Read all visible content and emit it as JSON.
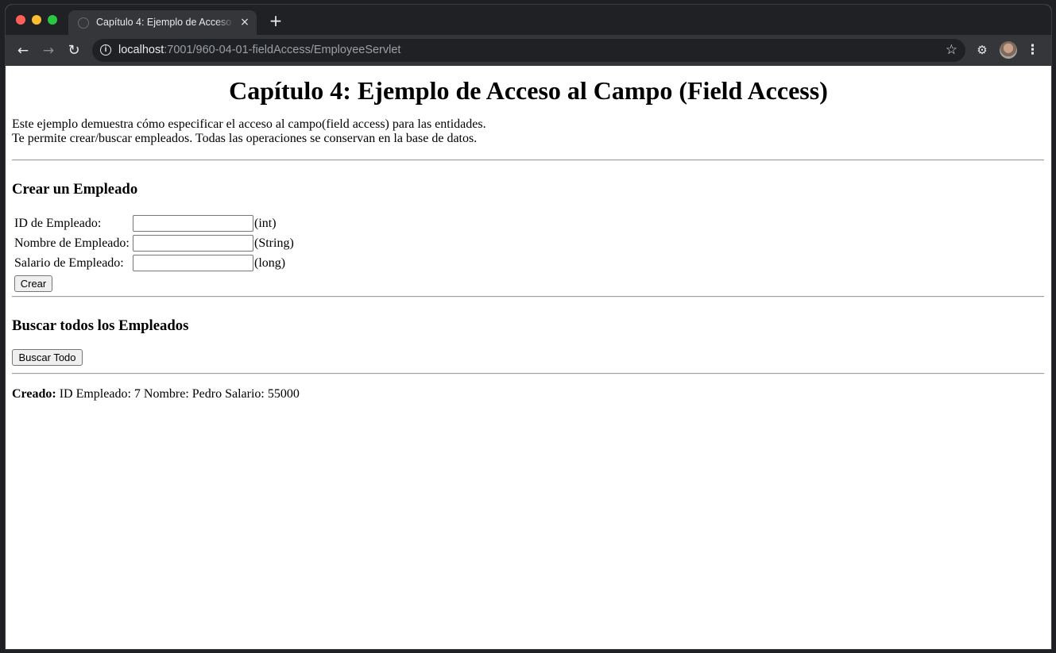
{
  "browser": {
    "tab_title": "Capítulo 4: Ejemplo de Acceso al Campo (Field Access)",
    "tab_close": "×",
    "new_tab": "+",
    "url_host": "localhost",
    "url_path": ":7001/960-04-01-fieldAccess/EmployeeServlet",
    "icons": {
      "back": "←",
      "forward": "→",
      "reload": "↻",
      "info": "i",
      "star": "☆",
      "extensions": "⚙",
      "menu": "⋮"
    }
  },
  "page": {
    "heading": "Capítulo 4: Ejemplo de Acceso al Campo (Field Access)",
    "desc_line1": "Este ejemplo demuestra cómo especificar el acceso al campo(field access) para las entidades.",
    "desc_line2": "Te permite crear/buscar empleados. Todas las operaciones se conservan en la base de datos.",
    "create_section": {
      "heading": "Crear un Empleado",
      "fields": [
        {
          "label": "ID de Empleado:",
          "value": "",
          "type_hint": "(int)"
        },
        {
          "label": "Nombre de Empleado:",
          "value": "",
          "type_hint": "(String)"
        },
        {
          "label": "Salario de Empleado:",
          "value": "",
          "type_hint": "(long)"
        }
      ],
      "submit_label": "Crear"
    },
    "find_section": {
      "heading": "Buscar todos los Empleados",
      "button_label": "Buscar Todo"
    },
    "result": {
      "prefix": "Creado:",
      "text": " ID Empleado: 7 Nombre: Pedro Salario: 55000"
    }
  }
}
